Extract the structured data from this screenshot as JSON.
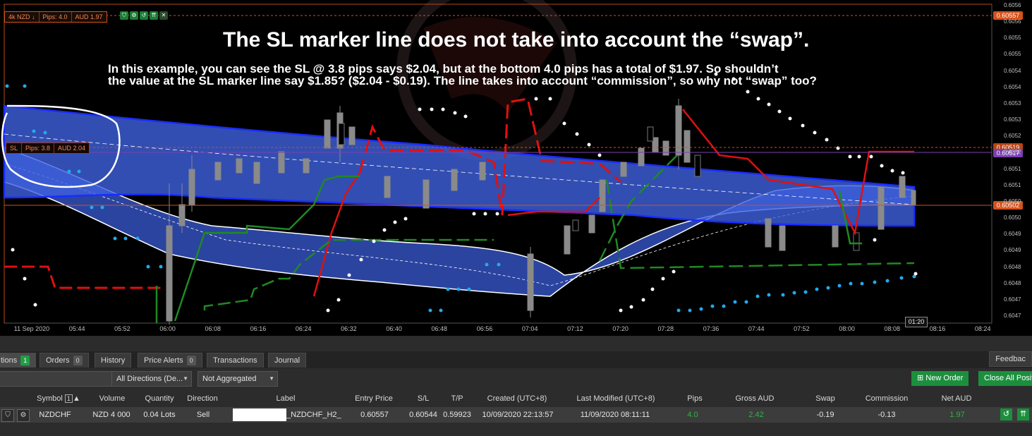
{
  "chart": {
    "position_chip": {
      "volume": "4k NZD ↓",
      "pips": "Pips: 4.0",
      "amount": "AUD 1.97"
    },
    "sl_chip": {
      "label": "SL",
      "pips": "Pips: 3.8",
      "amount": "AUD 2.04"
    },
    "price_tags": {
      "entry": "0.60557",
      "stop_loss": "0.60519",
      "stop_purple": "0.60517",
      "current": "0.60502"
    },
    "y_ticks": [
      "0.6056",
      "0.6056",
      "0.6055",
      "0.6055",
      "0.6054",
      "0.6054",
      "0.6053",
      "0.6053",
      "0.6052",
      "0.6052",
      "0.6051",
      "0.6051",
      "0.6050",
      "0.6050",
      "0.6049",
      "0.6049",
      "0.6048",
      "0.6048",
      "0.6047",
      "0.6047"
    ],
    "x_ticks": [
      "11 Sep 2020",
      "05:44",
      "05:52",
      "06:00",
      "06:08",
      "06:16",
      "06:24",
      "06:32",
      "06:40",
      "06:48",
      "06:56",
      "07:04",
      "07:12",
      "07:20",
      "07:28",
      "07:36",
      "07:44",
      "07:52",
      "08:00",
      "08:08",
      "08:16",
      "08:24"
    ],
    "time_box": "01:20",
    "colors": {
      "band": "#3a5bd6",
      "band_edge": "#1a2cff",
      "sl_line": "#e01010",
      "ts_line": "#1f8a22",
      "dots_white": "#ffffff",
      "dots_cyan": "#22aaee",
      "entry": "#d2521c"
    }
  },
  "annotation": {
    "title": "The SL marker line does not take into account the “swap”.",
    "line1": "In this example, you can see the SL @ 3.8 pips says $2.04, but at the bottom 4.0 pips has a total of $1.97. So shouldn’t",
    "line2": "the value at the SL marker line say $1.85? ($2.04 - $0.19). The line takes into account “commission”, so why not “swap” too?"
  },
  "tabs": [
    {
      "label": "tions",
      "count": "1"
    },
    {
      "label": "Orders",
      "count": "0"
    },
    {
      "label": "History"
    },
    {
      "label": "Price Alerts",
      "count": "0"
    },
    {
      "label": "Transactions"
    },
    {
      "label": "Journal"
    }
  ],
  "feedback": "Feedbac",
  "filters": {
    "direction": "All Directions (De...",
    "aggregation": "Not Aggregated"
  },
  "actions": {
    "new_order": "New Order",
    "close_all": "Close All Positi"
  },
  "columns": [
    "Symbol",
    "Volume",
    "Quantity",
    "Direction",
    "Label",
    "Entry Price",
    "S/L",
    "T/P",
    "Created (UTC+8)",
    "Last Modified (UTC+8)",
    "Pips",
    "Gross AUD",
    "Swap",
    "Commission",
    "Net AUD"
  ],
  "symbol_sort_badge": "1",
  "row": {
    "symbol": "NZDCHF",
    "volume": "NZD 4 000",
    "quantity": "0.04 Lots",
    "direction": "Sell",
    "label": "_NZDCHF_H2_",
    "entry_price": "0.60557",
    "sl": "0.60544",
    "tp": "0.59923",
    "created": "10/09/2020 22:13:57",
    "modified": "11/09/2020 08:11:11",
    "pips": "4.0",
    "gross": "2.42",
    "swap": "-0.19",
    "commission": "-0.13",
    "net": "1.97"
  }
}
